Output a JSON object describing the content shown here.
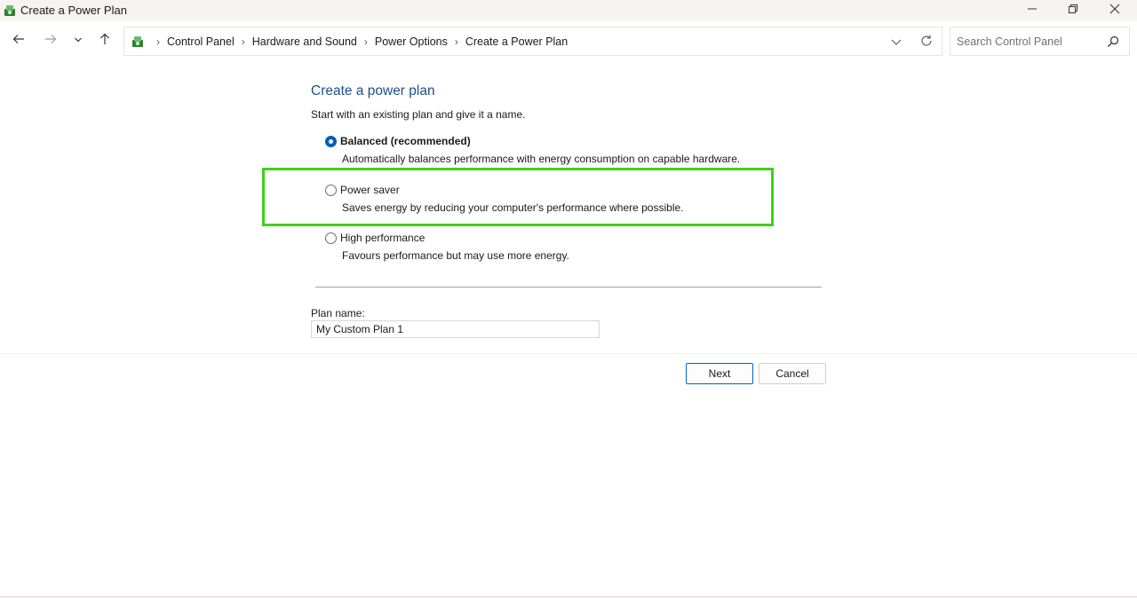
{
  "window": {
    "title": "Create a Power Plan",
    "minimize_icon": "minimize-icon",
    "restore_icon": "restore-icon",
    "close_icon": "close-icon"
  },
  "nav": {
    "back_icon": "arrow-left-icon",
    "forward_icon": "arrow-right-icon",
    "recent_icon": "chevron-down-icon",
    "up_icon": "arrow-up-icon",
    "breadcrumb": [
      "Control Panel",
      "Hardware and Sound",
      "Power Options",
      "Create a Power Plan"
    ],
    "search_placeholder": "Search Control Panel"
  },
  "content": {
    "title": "Create a power plan",
    "subtitle": "Start with an existing plan and give it a name.",
    "options": [
      {
        "label": "Balanced (recommended)",
        "description": "Automatically balances performance with energy consumption on capable hardware.",
        "selected": true
      },
      {
        "label": "Power saver",
        "description": "Saves energy by reducing your computer's performance where possible.",
        "selected": false
      },
      {
        "label": "High performance",
        "description": "Favours performance but may use more energy.",
        "selected": false
      }
    ],
    "plan_name_label": "Plan name:",
    "plan_name_value": "My Custom Plan 1"
  },
  "buttons": {
    "next": "Next",
    "cancel": "Cancel"
  },
  "colors": {
    "title_blue": "#1e4e8c",
    "highlight_green": "#3fd11a",
    "accent": "#005fb8"
  }
}
